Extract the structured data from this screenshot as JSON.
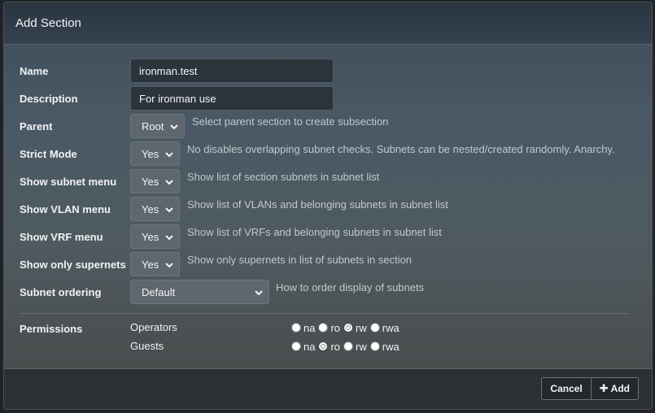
{
  "modal": {
    "title": "Add Section"
  },
  "form": {
    "name": {
      "label": "Name",
      "value": "ironman.test"
    },
    "description": {
      "label": "Description",
      "value": "For ironman use"
    },
    "parent": {
      "label": "Parent",
      "value": "Root",
      "help": "Select parent section to create subsection"
    },
    "strict_mode": {
      "label": "Strict Mode",
      "value": "Yes",
      "help": "No disables overlapping subnet checks. Subnets can be nested/created randomly. Anarchy."
    },
    "show_subnet_menu": {
      "label": "Show subnet menu",
      "value": "Yes",
      "help": "Show list of section subnets in subnet list"
    },
    "show_vlan_menu": {
      "label": "Show VLAN menu",
      "value": "Yes",
      "help": "Show list of VLANs and belonging subnets in subnet list"
    },
    "show_vrf_menu": {
      "label": "Show VRF menu",
      "value": "Yes",
      "help": "Show list of VRFs and belonging subnets in subnet list"
    },
    "show_only_supernets": {
      "label": "Show only supernets",
      "value": "Yes",
      "help": "Show only supernets in list of subnets in section"
    },
    "subnet_ordering": {
      "label": "Subnet ordering",
      "value": "Default",
      "help": "How to order display of subnets"
    }
  },
  "permissions": {
    "label": "Permissions",
    "options": [
      "na",
      "ro",
      "rw",
      "rwa"
    ],
    "groups": [
      {
        "name": "Operators",
        "selected": "rw"
      },
      {
        "name": "Guests",
        "selected": "ro"
      }
    ]
  },
  "footer": {
    "cancel_label": "Cancel",
    "add_label": "Add",
    "add_icon": "plus-icon"
  }
}
